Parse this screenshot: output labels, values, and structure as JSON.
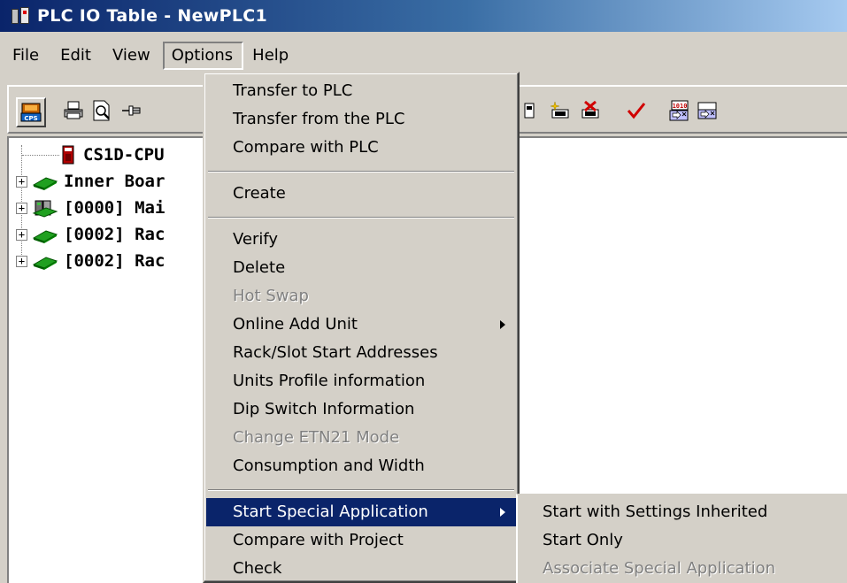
{
  "window": {
    "title": "PLC IO Table - NewPLC1"
  },
  "menubar": {
    "items": [
      "File",
      "Edit",
      "View",
      "Options",
      "Help"
    ]
  },
  "toolbar": {
    "buttons": [
      {
        "icon": "cps-icon"
      },
      {
        "icon": "printer-icon"
      },
      {
        "icon": "print-preview-icon"
      },
      {
        "icon": "pin-icon"
      },
      {
        "icon": "unit-icon"
      },
      {
        "icon": "add-unit-icon"
      },
      {
        "icon": "delete-unit-icon"
      },
      {
        "icon": "check-icon"
      },
      {
        "icon": "transfer-binary-icon"
      },
      {
        "icon": "transfer-icon"
      }
    ]
  },
  "tree": {
    "nodes": [
      {
        "label": "CS1D-CPU",
        "icon": "cpu-icon"
      },
      {
        "label": "Inner Boar",
        "icon": "board-icon"
      },
      {
        "label": "[0000] Mai",
        "icon": "main-rack-icon"
      },
      {
        "label": "[0002] Rac",
        "icon": "rack-icon"
      },
      {
        "label": "[0002] Rac",
        "icon": "rack-icon"
      }
    ]
  },
  "options_menu": {
    "transfer_to_plc": "Transfer to PLC",
    "transfer_from_plc": "Transfer from the PLC",
    "compare_with_plc": "Compare with PLC",
    "create": "Create",
    "verify": "Verify",
    "delete": "Delete",
    "hot_swap": "Hot Swap",
    "online_add_unit": "Online Add Unit",
    "rack_slot_start": "Rack/Slot Start Addresses",
    "units_profile": "Units Profile information",
    "dip_switch": "Dip Switch Information",
    "change_etn21": "Change ETN21 Mode",
    "consumption_width": "Consumption and Width",
    "start_special_app": "Start Special Application",
    "compare_with_project": "Compare with Project",
    "check": "Check"
  },
  "submenu": {
    "start_with_settings": "Start with Settings Inherited",
    "start_only": "Start Only",
    "associate_special": "Associate Special Application"
  },
  "colors": {
    "face": "#d4d0c8",
    "highlight": "#0a246a",
    "title_gradient_start": "#0a246a",
    "title_gradient_end": "#a6caf0"
  }
}
